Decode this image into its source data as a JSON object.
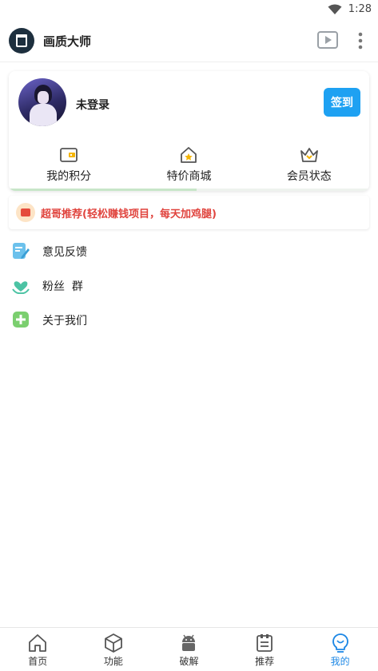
{
  "status_bar": {
    "time": "1:28"
  },
  "app_bar": {
    "title": "画质大师",
    "icons": [
      "app-logo",
      "play-icon",
      "more-vertical-icon"
    ]
  },
  "profile": {
    "username": "未登录",
    "signin_label": "签到",
    "progress_fraction": 0.52,
    "features": [
      {
        "icon": "wallet-icon",
        "label": "我的积分"
      },
      {
        "icon": "shop-icon",
        "label": "特价商城"
      },
      {
        "icon": "crown-icon",
        "label": "会员状态"
      }
    ]
  },
  "promo": {
    "icon": "gift-icon",
    "text": "超哥推荐(轻松赚钱项目，每天加鸡腿)"
  },
  "menu": [
    {
      "icon": "feedback-icon",
      "label": "意见反馈"
    },
    {
      "icon": "fans-group-icon",
      "label": "粉丝  群"
    },
    {
      "icon": "about-icon",
      "label": "关于我们"
    }
  ],
  "bottom_nav": [
    {
      "icon": "home-icon",
      "label": "首页",
      "active": false
    },
    {
      "icon": "cube-icon",
      "label": "功能",
      "active": false
    },
    {
      "icon": "android-icon",
      "label": "破解",
      "active": false
    },
    {
      "icon": "list-icon",
      "label": "推荐",
      "active": false
    },
    {
      "icon": "bulb-icon",
      "label": "我的",
      "active": true
    }
  ],
  "colors": {
    "accent": "#1ea1f2",
    "promo_text": "#e0443e",
    "nav_active": "#1e88e5",
    "logo_bg": "#1d2f3e"
  }
}
